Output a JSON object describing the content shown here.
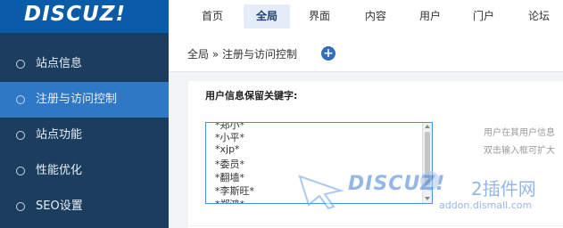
{
  "logo": "DISCUZ!",
  "nav": [
    {
      "label": "首页",
      "active": false
    },
    {
      "label": "全局",
      "active": true
    },
    {
      "label": "界面",
      "active": false
    },
    {
      "label": "内容",
      "active": false
    },
    {
      "label": "用户",
      "active": false
    },
    {
      "label": "门户",
      "active": false
    },
    {
      "label": "论坛",
      "active": false
    }
  ],
  "sidebar": [
    {
      "label": "站点信息",
      "active": false
    },
    {
      "label": "注册与访问控制",
      "active": true
    },
    {
      "label": "站点功能",
      "active": false
    },
    {
      "label": "性能优化",
      "active": false
    },
    {
      "label": "SEO设置",
      "active": false
    }
  ],
  "breadcrumb": "全局 » 注册与访问控制",
  "form": {
    "label": "用户信息保留关键字:",
    "keywords": [
      "*郑小*",
      "*小平*",
      "*xjp*",
      "*委员*",
      "*翻墙*",
      "*李斯旺*",
      "*郑鸿*"
    ],
    "hints": [
      "用户在其用户信息",
      "双击输入框可扩大"
    ]
  },
  "watermark": {
    "text": "DISCUZ!",
    "cn": "2插件网",
    "url": "addon.dismall.com"
  }
}
